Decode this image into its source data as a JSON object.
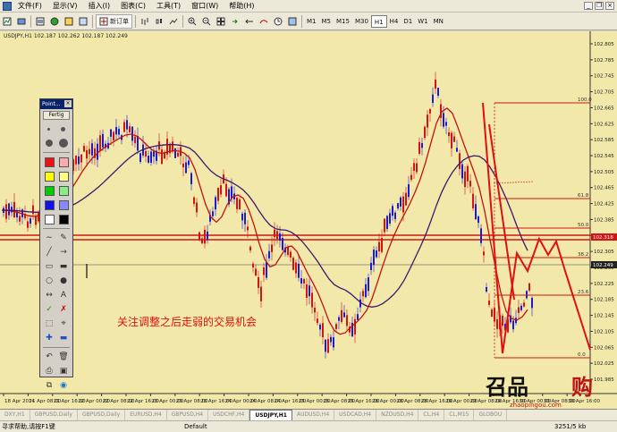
{
  "menu": {
    "items": [
      "文件(F)",
      "显示(V)",
      "插入(I)",
      "图表(C)",
      "工具(T)",
      "窗口(W)",
      "帮助(H)"
    ]
  },
  "toolbar": {
    "new_order_label": "新订单",
    "timeframes": [
      "M1",
      "M5",
      "M15",
      "M30",
      "H1",
      "H4",
      "D1",
      "W1",
      "MN"
    ],
    "selected_timeframe": "H1"
  },
  "chart": {
    "symbol_info": "USDJPY,H1  102.187 102.262 102.187 102.249",
    "annotation_text": "关注调整之后走弱的交易机会",
    "current_price_label": "102.249",
    "marked_level_label": "102.318",
    "price_ticks": [
      "102.805",
      "102.785",
      "102.745",
      "102.705",
      "102.665",
      "102.625",
      "102.585",
      "102.545",
      "102.505",
      "102.465",
      "102.425",
      "102.385",
      "102.345",
      "102.305",
      "102.265",
      "102.225",
      "102.185",
      "102.145",
      "102.105",
      "102.065",
      "102.025",
      "101.985"
    ],
    "fib_labels": [
      "100.0",
      "61.8",
      "50.0",
      "38.2",
      "23.6",
      "0.0"
    ],
    "time_labels": [
      "18 Apr 2014",
      "21 Apr 08:00",
      "21 Apr 16:00",
      "22 Apr 00:00",
      "22 Apr 08:00",
      "22 Apr 16:00",
      "23 Apr 00:00",
      "23 Apr 08:00",
      "23 Apr 16:00",
      "24 Apr 00:00",
      "24 Apr 08:00",
      "24 Apr 16:00",
      "25 Apr 00:00",
      "25 Apr 08:00",
      "25 Apr 16:00",
      "28 Apr 00:00",
      "28 Apr 08:00",
      "28 Apr 16:00",
      "29 Apr 00:00",
      "29 Apr 08:00",
      "29 Apr 16:00",
      "30 Apr 00:00",
      "30 Apr 08:00",
      "30 Apr 16:00"
    ],
    "watermark_cn": "召品",
    "watermark_cn2": "购",
    "watermark_url": "zhaopingou.com",
    "colors": {
      "background": "#f2e8a9",
      "up_candle": "#1b1bd6",
      "down_candle": "#d41414",
      "ma_fast": "#c41010",
      "ma_slow": "#3b1870",
      "annotation": "#e01010",
      "fib": "#d21414"
    }
  },
  "tabs": {
    "items": [
      "DXY,H1",
      "GBPUSD,Daily",
      "GBPUSD,Daily",
      "EURUSD,H4",
      "GBPUSD,H4",
      "USDCHF,H4",
      "USDJPY,H1",
      "AUDUSD,H4",
      "USDCAD,H4",
      "NZDUSD,H4",
      "CL,H4",
      "CL,M15",
      "GLOBOU"
    ],
    "active_index": 6
  },
  "status": {
    "help_text": "寻求帮助,请按F1键",
    "profile": "Default",
    "traffic": "3251/5 kb"
  },
  "draw_panel": {
    "title": "Point...",
    "button_label": "Fertig",
    "colors": [
      "#ee1111",
      "#ffaaaa",
      "#ffff00",
      "#ffff88",
      "#00cc00",
      "#88ee88",
      "#1111ee",
      "#8888ff",
      "#ffffff",
      "#000000"
    ]
  }
}
